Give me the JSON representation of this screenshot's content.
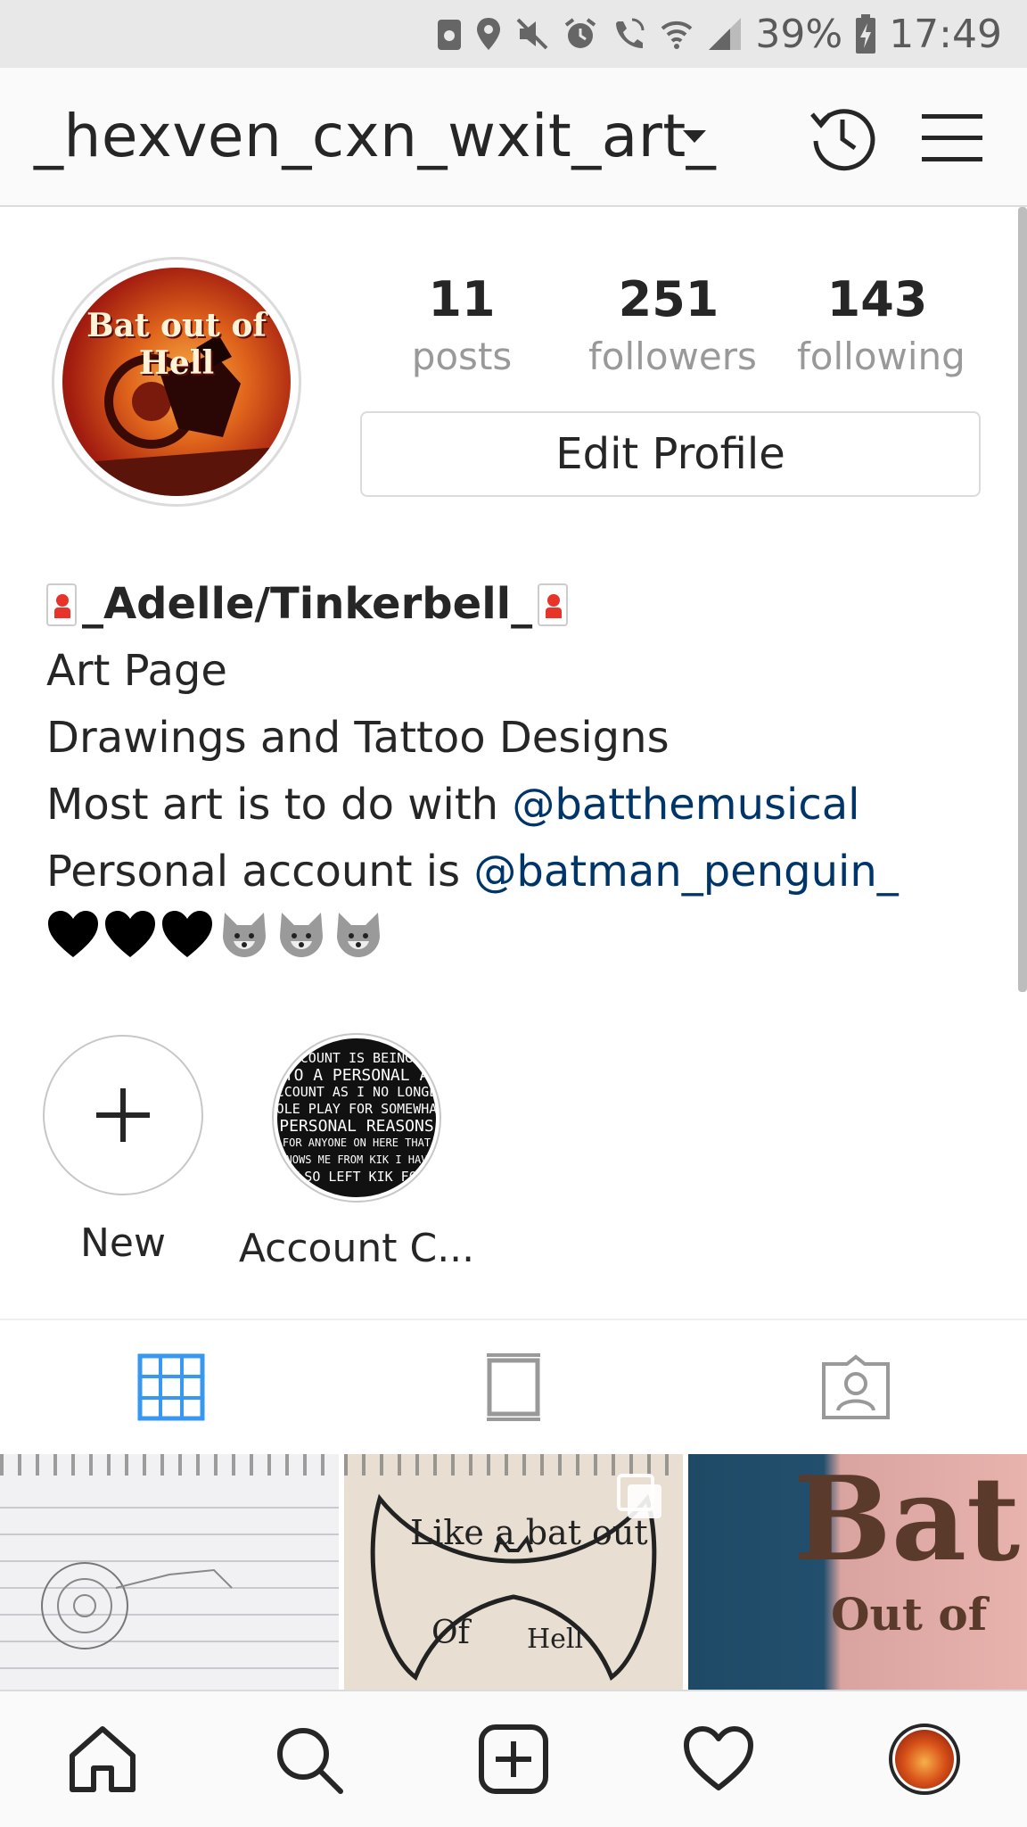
{
  "status_bar": {
    "battery": "39%",
    "time": "17:49",
    "icons": [
      "sim-icon",
      "location-icon",
      "mute-icon",
      "alarm-icon",
      "wifi-call-icon",
      "wifi-icon",
      "signal-icon",
      "battery-icon"
    ]
  },
  "header": {
    "username": "_hexven_cxn_wxit_art_",
    "icons": [
      "archive-history-icon",
      "menu-icon"
    ]
  },
  "profile": {
    "avatar_text": "Bat out of Hell",
    "stats": [
      {
        "value": "11",
        "label": "posts"
      },
      {
        "value": "251",
        "label": "followers"
      },
      {
        "value": "143",
        "label": "following"
      }
    ],
    "edit_button": "Edit Profile"
  },
  "bio": {
    "name": "_Adelle/Tinkerbell_",
    "lines": [
      "Art Page",
      "Drawings and Tattoo Designs"
    ],
    "line3_prefix": "Most art is to do with ",
    "line3_mention": "@batthemusical",
    "line4_prefix": "Personal account is ",
    "line4_mention": "@batman_penguin_",
    "emojis": "🖤🖤🖤🐺🐺🐺"
  },
  "highlights": [
    {
      "label": "New"
    },
    {
      "label": "Account C..."
    }
  ],
  "highlight_thumb_text": [
    "ACCOUNT IS BEING M",
    "NTO A PERSONAL AR",
    "ACCOUNT AS I NO LONGER",
    "ROLE PLAY FOR SOMEWHAT",
    "PERSONAL REASONS",
    "FOR ANYONE ON HERE THAT",
    "KNOWS ME FROM KIK I HAVE",
    "ALSO LEFT KIK FOR"
  ],
  "tabs": [
    "grid-icon",
    "feed-icon",
    "tagged-icon"
  ],
  "active_tab_color": "#3897f0",
  "grid_posts": [
    {
      "text": ""
    },
    {
      "text": "Like a bat out",
      "text2": "Of",
      "text3": "Hell"
    },
    {
      "text": "Bat",
      "text2": "Out of"
    }
  ],
  "bottom_nav": [
    "home-icon",
    "search-icon",
    "add-post-icon",
    "activity-heart-icon",
    "profile-avatar"
  ]
}
